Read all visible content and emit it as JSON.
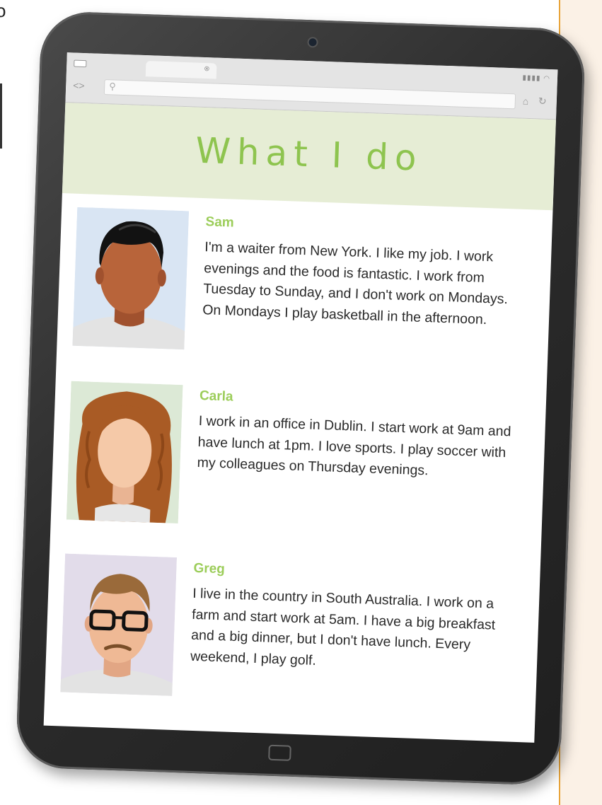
{
  "page_title": "What I do",
  "browser": {
    "tab_close": "⊗",
    "signal": "▮▮▮▮ ◠",
    "nav": "<>",
    "search_icon": "search-icon",
    "home_icon": "home-icon",
    "refresh_icon": "refresh-icon"
  },
  "people": [
    {
      "name": "Sam",
      "text": "I'm a waiter from New York. I like my job. I work evenings and the food is fantastic. I work from Tuesday to Sunday, and I don't work on Mondays. On Mondays I play basketball in the afternoon.",
      "portrait_bg": "#d9e5f3"
    },
    {
      "name": "Carla",
      "text": "I work in an office in Dublin. I start work at 9am and have lunch at 1pm. I love sports. I play soccer with my colleagues on Thursday evenings.",
      "portrait_bg": "#dce9d6"
    },
    {
      "name": "Greg",
      "text": "I live in the country in South Australia. I work on a farm and start work at 5am. I have a big breakfast and a big dinner, but I don't have lunch. Every weekend, I play golf.",
      "portrait_bg": "#e2dcea"
    }
  ],
  "colors": {
    "accent_green": "#8ec44f",
    "header_band": "#e6edd5",
    "tablet_frame": "#2c2c2c",
    "page_border": "#e8a43a"
  }
}
